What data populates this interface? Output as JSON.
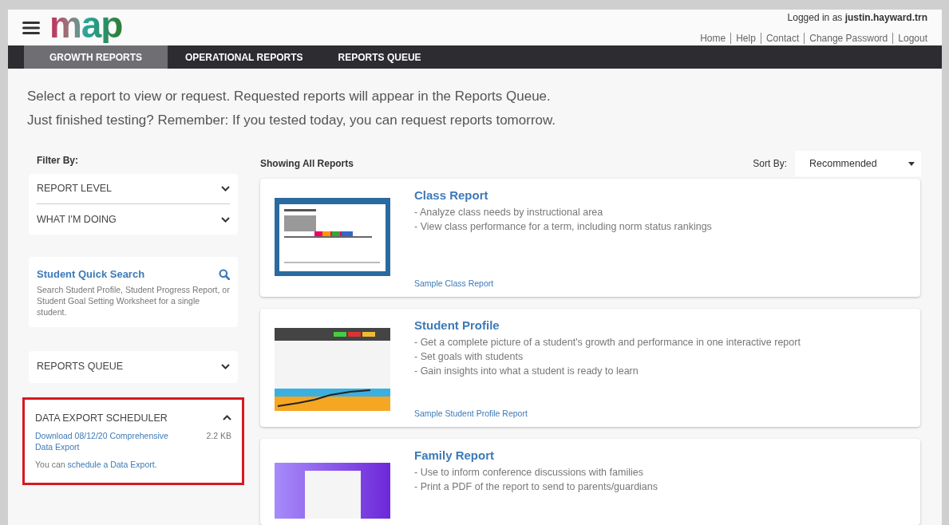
{
  "header": {
    "logo": "map",
    "login_prefix": "Logged in as",
    "username": "justin.hayward.trn",
    "links": [
      "Home",
      "Help",
      "Contact",
      "Change Password",
      "Logout"
    ]
  },
  "tabs": [
    {
      "label": "GROWTH REPORTS",
      "selected": true
    },
    {
      "label": "OPERATIONAL REPORTS",
      "selected": false
    },
    {
      "label": "REPORTS QUEUE",
      "selected": false
    }
  ],
  "intro": [
    "Select a report to view or request. Requested reports will appear in the Reports Queue.",
    "Just finished testing? Remember: If you tested today, you can request reports tomorrow."
  ],
  "filter": {
    "title": "Filter By:",
    "items": [
      {
        "label": "REPORT LEVEL",
        "expanded": false
      },
      {
        "label": "WHAT I'M DOING",
        "expanded": false
      }
    ]
  },
  "quick_search": {
    "title": "Student Quick Search",
    "description": "Search Student Profile, Student Progress Report, or Student Goal Setting Worksheet for a single student."
  },
  "reports_queue": {
    "label": "REPORTS QUEUE",
    "expanded": false
  },
  "data_export": {
    "label": "DATA EXPORT SCHEDULER",
    "expanded": true,
    "highlighted": true,
    "download_link": "Download 08/12/20 Comprehensive Data Export",
    "size": "2.2 KB",
    "note_prefix": "You can",
    "note_link": "schedule a Data Export."
  },
  "results": {
    "heading": "Showing All Reports",
    "sort_label": "Sort By:",
    "sort_value": "Recommended"
  },
  "reports": [
    {
      "kind": "class",
      "title": "Class Report",
      "bullets": [
        "- Analyze class needs by instructional area",
        "- View class performance for a term, including norm status rankings"
      ],
      "sample_link": "Sample Class Report"
    },
    {
      "kind": "profile",
      "title": "Student Profile",
      "bullets": [
        "- Get a complete picture of a student's growth and performance in one interactive report",
        "- Set goals with students",
        "- Gain insights into what a student is ready to learn"
      ],
      "sample_link": "Sample Student Profile Report"
    },
    {
      "kind": "family",
      "title": "Family Report",
      "bullets": [
        "- Use to inform conference discussions with families",
        "- Print a PDF of the report to send to parents/guardians"
      ]
    }
  ]
}
